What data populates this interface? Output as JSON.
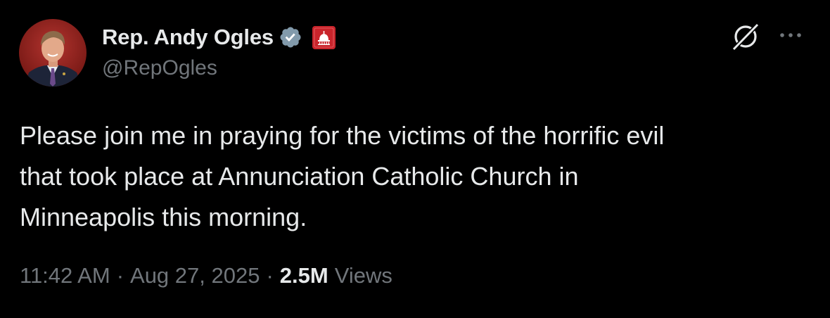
{
  "author": {
    "display_name": "Rep. Andy Ogles",
    "handle": "@RepOgles",
    "verified_badge_color": "#829aab",
    "affiliation_badge_color": "#c9242b"
  },
  "icons": {
    "grok": "grok-icon",
    "more": "more-icon",
    "verified": "verified-badge-icon",
    "affiliation": "capitol-badge-icon"
  },
  "tweet": {
    "text": "Please join me in praying for the victims of the horrific evil\nthat took place at Annunciation Catholic Church in\nMinneapolis this morning."
  },
  "meta": {
    "time": "11:42 AM",
    "separator": "·",
    "date": "Aug 27, 2025",
    "views_count": "2.5M",
    "views_label": "Views"
  },
  "colors": {
    "background": "#000000",
    "primary_text": "#e7e9ea",
    "secondary_text": "#71767b"
  }
}
